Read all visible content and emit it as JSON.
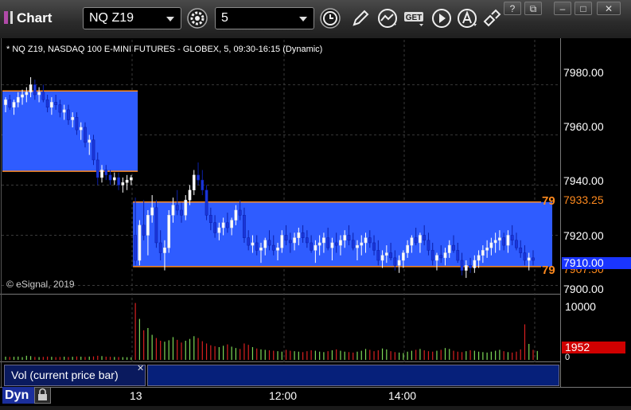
{
  "window": {
    "title": "Chart",
    "symbol_value": "NQ Z19",
    "interval_value": "5",
    "toolbar_icons": [
      "settings-gear-icon",
      "clock-icon",
      "pencil-draw-icon",
      "chart-trend-icon",
      "get-data-icon",
      "play-icon",
      "alert-a-icon",
      "tools-icon"
    ],
    "window_buttons": [
      "?",
      "restore",
      "minimize",
      "maximize",
      "close"
    ]
  },
  "chart": {
    "legend": "* NQ Z19, NASDAQ 100 E-MINI FUTURES - GLOBEX, 5, 09:30-16:15 (Dynamic)",
    "copyright": "© eSignal, 2019",
    "price_ticks": [
      "7980.00",
      "7960.00",
      "7940.00",
      "7920.00",
      "7900.00"
    ],
    "volume_ticks": [
      "10000",
      "0"
    ],
    "time_ticks": [
      "13",
      "12:00",
      "14:00"
    ],
    "last_price": "7910.00",
    "level_high_price": "7933.25",
    "level_low_price": "7907.50",
    "level_tag_high": "79",
    "level_tag_low": "79",
    "last_volume": "1952",
    "study_label": "Vol (current price bar)",
    "tab_label": "Dyn",
    "colors": {
      "background": "#000000",
      "range_fill": "#2f5cff",
      "range_line": "#ff8a1e",
      "up_candle": "#ffffff",
      "down_candle": "#1a35d8",
      "vol_up": "#7ed957",
      "vol_down": "#d92020",
      "last_price_bg": "#1a35ff",
      "last_volume_bg": "#d00000"
    }
  },
  "chart_data": {
    "type": "candlestick",
    "ylim": [
      7897,
      7989
    ],
    "price_ticks": [
      7980,
      7960,
      7940,
      7920,
      7900
    ],
    "ranges": [
      {
        "start_bar": 0,
        "end_bar": 31,
        "high": 7977.5,
        "low": 7945.5
      },
      {
        "start_bar": 31,
        "end_bar": 130,
        "high": 7933.25,
        "low": 7907.5
      }
    ],
    "candles": [
      [
        7972,
        7975,
        7969,
        7974
      ],
      [
        7974,
        7976,
        7970,
        7971
      ],
      [
        7971,
        7974,
        7968,
        7973
      ],
      [
        7973,
        7977,
        7971,
        7975
      ],
      [
        7975,
        7978,
        7972,
        7976
      ],
      [
        7976,
        7979,
        7973,
        7977
      ],
      [
        7977,
        7983,
        7975,
        7980
      ],
      [
        7980,
        7982,
        7974,
        7976
      ],
      [
        7976,
        7979,
        7973,
        7977
      ],
      [
        7977,
        7980,
        7973,
        7974
      ],
      [
        7974,
        7976,
        7969,
        7971
      ],
      [
        7971,
        7975,
        7968,
        7973
      ],
      [
        7973,
        7976,
        7970,
        7972
      ],
      [
        7972,
        7974,
        7967,
        7969
      ],
      [
        7969,
        7972,
        7966,
        7970
      ],
      [
        7970,
        7972,
        7964,
        7966
      ],
      [
        7966,
        7969,
        7963,
        7967
      ],
      [
        7967,
        7969,
        7960,
        7962
      ],
      [
        7962,
        7965,
        7958,
        7963
      ],
      [
        7963,
        7965,
        7955,
        7957
      ],
      [
        7957,
        7960,
        7952,
        7958
      ],
      [
        7958,
        7960,
        7948,
        7950
      ],
      [
        7950,
        7953,
        7940,
        7943
      ],
      [
        7943,
        7948,
        7941,
        7946
      ],
      [
        7946,
        7948,
        7942,
        7944
      ],
      [
        7944,
        7946,
        7940,
        7942
      ],
      [
        7942,
        7945,
        7940,
        7943
      ],
      [
        7943,
        7945,
        7938,
        7940
      ],
      [
        7940,
        7943,
        7937,
        7941
      ],
      [
        7941,
        7944,
        7938,
        7942
      ],
      [
        7942,
        7944,
        7940,
        7943
      ],
      [
        7920,
        7935,
        7908,
        7910
      ],
      [
        7910,
        7926,
        7908,
        7924
      ],
      [
        7924,
        7934,
        7918,
        7920
      ],
      [
        7920,
        7930,
        7912,
        7928
      ],
      [
        7928,
        7936,
        7925,
        7931
      ],
      [
        7931,
        7934,
        7915,
        7917
      ],
      [
        7917,
        7922,
        7910,
        7913
      ],
      [
        7913,
        7918,
        7906,
        7915
      ],
      [
        7915,
        7930,
        7913,
        7928
      ],
      [
        7928,
        7935,
        7925,
        7932
      ],
      [
        7932,
        7938,
        7928,
        7930
      ],
      [
        7930,
        7933,
        7925,
        7928
      ],
      [
        7928,
        7936,
        7926,
        7934
      ],
      [
        7934,
        7940,
        7932,
        7938
      ],
      [
        7938,
        7946,
        7936,
        7944
      ],
      [
        7944,
        7949,
        7940,
        7942
      ],
      [
        7942,
        7946,
        7936,
        7938
      ],
      [
        7938,
        7940,
        7926,
        7928
      ],
      [
        7928,
        7931,
        7922,
        7925
      ],
      [
        7925,
        7928,
        7919,
        7921
      ],
      [
        7921,
        7925,
        7918,
        7923
      ],
      [
        7923,
        7927,
        7920,
        7925
      ],
      [
        7925,
        7929,
        7921,
        7923
      ],
      [
        7923,
        7927,
        7920,
        7926
      ],
      [
        7926,
        7932,
        7924,
        7930
      ],
      [
        7930,
        7934,
        7926,
        7928
      ],
      [
        7928,
        7931,
        7917,
        7919
      ],
      [
        7919,
        7922,
        7914,
        7916
      ],
      [
        7916,
        7920,
        7913,
        7917
      ],
      [
        7917,
        7920,
        7912,
        7914
      ],
      [
        7914,
        7917,
        7909,
        7915
      ],
      [
        7915,
        7919,
        7912,
        7918
      ],
      [
        7918,
        7922,
        7914,
        7916
      ],
      [
        7916,
        7920,
        7912,
        7914
      ],
      [
        7914,
        7917,
        7910,
        7915
      ],
      [
        7915,
        7922,
        7913,
        7920
      ],
      [
        7920,
        7924,
        7916,
        7918
      ],
      [
        7918,
        7921,
        7913,
        7917
      ],
      [
        7917,
        7921,
        7914,
        7919
      ],
      [
        7919,
        7923,
        7916,
        7921
      ],
      [
        7921,
        7924,
        7917,
        7919
      ],
      [
        7919,
        7922,
        7915,
        7917
      ],
      [
        7917,
        7920,
        7913,
        7914
      ],
      [
        7914,
        7918,
        7909,
        7916
      ],
      [
        7916,
        7920,
        7912,
        7917
      ],
      [
        7917,
        7921,
        7913,
        7919
      ],
      [
        7919,
        7923,
        7914,
        7915
      ],
      [
        7915,
        7919,
        7910,
        7917
      ],
      [
        7917,
        7921,
        7913,
        7916
      ],
      [
        7916,
        7920,
        7912,
        7918
      ],
      [
        7918,
        7922,
        7915,
        7920
      ],
      [
        7920,
        7924,
        7916,
        7918
      ],
      [
        7918,
        7921,
        7914,
        7915
      ],
      [
        7915,
        7918,
        7910,
        7916
      ],
      [
        7916,
        7920,
        7912,
        7917
      ],
      [
        7917,
        7921,
        7913,
        7919
      ],
      [
        7919,
        7922,
        7915,
        7917
      ],
      [
        7917,
        7920,
        7912,
        7914
      ],
      [
        7914,
        7918,
        7908,
        7910
      ],
      [
        7910,
        7914,
        7907,
        7912
      ],
      [
        7912,
        7916,
        7909,
        7913
      ],
      [
        7913,
        7917,
        7910,
        7911
      ],
      [
        7911,
        7914,
        7906,
        7908
      ],
      [
        7908,
        7912,
        7905,
        7910
      ],
      [
        7910,
        7914,
        7907,
        7913
      ],
      [
        7913,
        7918,
        7911,
        7916
      ],
      [
        7916,
        7920,
        7913,
        7919
      ],
      [
        7919,
        7923,
        7916,
        7917
      ],
      [
        7917,
        7921,
        7913,
        7920
      ],
      [
        7920,
        7924,
        7916,
        7918
      ],
      [
        7918,
        7921,
        7912,
        7914
      ],
      [
        7914,
        7917,
        7908,
        7910
      ],
      [
        7910,
        7913,
        7906,
        7912
      ],
      [
        7912,
        7916,
        7909,
        7911
      ],
      [
        7911,
        7915,
        7908,
        7913
      ],
      [
        7913,
        7918,
        7911,
        7916
      ],
      [
        7916,
        7920,
        7913,
        7914
      ],
      [
        7914,
        7917,
        7909,
        7910
      ],
      [
        7910,
        7913,
        7904,
        7906
      ],
      [
        7906,
        7910,
        7903,
        7908
      ],
      [
        7908,
        7911,
        7905,
        7907
      ],
      [
        7907,
        7912,
        7905,
        7910
      ],
      [
        7910,
        7914,
        7907,
        7912
      ],
      [
        7912,
        7916,
        7909,
        7914
      ],
      [
        7914,
        7918,
        7911,
        7915
      ],
      [
        7915,
        7919,
        7912,
        7917
      ],
      [
        7917,
        7921,
        7913,
        7918
      ],
      [
        7918,
        7922,
        7914,
        7919
      ],
      [
        7919,
        7921,
        7914,
        7916
      ],
      [
        7916,
        7922,
        7913,
        7920
      ],
      [
        7920,
        7924,
        7916,
        7918
      ],
      [
        7918,
        7921,
        7914,
        7915
      ],
      [
        7915,
        7918,
        7911,
        7913
      ],
      [
        7913,
        7916,
        7908,
        7910
      ],
      [
        7910,
        7913,
        7906,
        7911
      ],
      [
        7911,
        7914,
        7908,
        7910
      ]
    ],
    "volume_ylim": [
      0,
      14000
    ],
    "volume_ticks": [
      10000,
      0
    ],
    "volume": [
      700,
      650,
      680,
      720,
      600,
      900,
      820,
      640,
      610,
      660,
      720,
      680,
      600,
      640,
      700,
      620,
      680,
      750,
      700,
      640,
      720,
      760,
      900,
      820,
      700,
      680,
      640,
      620,
      600,
      580,
      560,
      12500,
      9000,
      6500,
      7000,
      5500,
      4800,
      4200,
      4000,
      4300,
      5000,
      4400,
      3800,
      4200,
      4600,
      5200,
      4800,
      4100,
      3600,
      3200,
      3000,
      2800,
      3100,
      3400,
      2900,
      2600,
      2400,
      3600,
      3300,
      2800,
      2500,
      2300,
      2200,
      2100,
      2000,
      1900,
      1800,
      2200,
      2000,
      1900,
      1800,
      1700,
      1900,
      2100,
      2000,
      1800,
      1700,
      1900,
      2100,
      2300,
      2000,
      1800,
      1700,
      1600,
      1800,
      2000,
      2400,
      2200,
      1900,
      2100,
      2500,
      2300,
      1900,
      1700,
      1600,
      1500,
      1800,
      2000,
      2200,
      2400,
      2100,
      1900,
      1800,
      2000,
      2200,
      2600,
      2400,
      2000,
      1800,
      1700,
      1900,
      2100,
      2000,
      1800,
      1700,
      1600,
      1800,
      2000,
      2200,
      1900,
      1700,
      1600,
      1800,
      2300,
      7800,
      3500,
      2200,
      1952
    ]
  }
}
